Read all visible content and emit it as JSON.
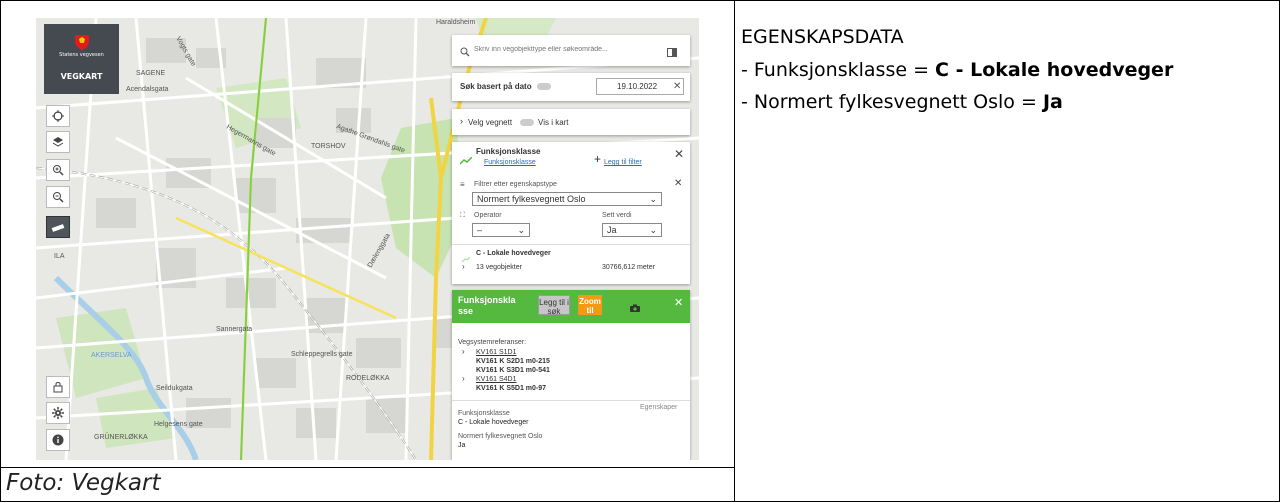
{
  "properties": {
    "title": "EGENSKAPSDATA",
    "items": [
      {
        "prefix": "- ",
        "label": "Funksjonsklasse = ",
        "value": "C - Lokale hovedveger"
      },
      {
        "prefix": "- ",
        "label": "Normert fylkesvegnett Oslo = ",
        "value": "Ja"
      }
    ]
  },
  "caption": "Foto: Vegkart",
  "app": {
    "org": "Statens vegvesen",
    "name": "VEGKART"
  },
  "search": {
    "placeholder": "Skriv inn vegobjekttype eller søkeområde...",
    "date_label": "Søk basert på dato",
    "date_value": "19.10.2022"
  },
  "network": {
    "label": "Velg vegnett",
    "show_label": "Vis i kart"
  },
  "filter_panel": {
    "title": "Funksjonsklasse",
    "sub_link": "Funksjonsklasse",
    "add_filter": "Legg til filter",
    "filter_label": "Filtrer etter egenskapstype",
    "property_select": "Normert fylkesvegnett Oslo",
    "operator_label": "Operator",
    "operator_value": "–",
    "value_label": "Sett verdi",
    "value_value": "Ja",
    "result_class": "C - Lokale hovedveger",
    "result_count": "13 vegobjekter",
    "result_length": "30766,612 meter"
  },
  "detail_panel": {
    "title": "Funksjonskla sse",
    "add_to_search": "Legg til i søk",
    "zoom": "Zoom til",
    "ref_label": "Vegsystemreferanser:",
    "refs": [
      {
        "link": "KV161 S1D1",
        "lines": [
          "KV161 K S2D1 m0-215",
          "KV161 K S3D1 m0-541"
        ]
      },
      {
        "link": "KV161 S4D1",
        "lines": [
          "KV161 K S5D1 m0-97"
        ]
      }
    ],
    "props_tab": "Egenskaper",
    "prop1_name": "Funksjonsklasse",
    "prop1_value": "C - Lokale hovedveger",
    "prop2_name": "Normert fylkesvegnett Oslo",
    "prop2_value": "Ja"
  },
  "map_labels": {
    "l1": "SAGENE",
    "l2": "Acendalsgata",
    "l3": "TORSHOV",
    "l4": "AKERSELVA",
    "l5": "RODELØKKA",
    "l6": "GRÜNERLØKKA",
    "l7": "Haraldsheim",
    "l8": "Agathe Grøndahls gate",
    "l9": "Sannergata",
    "l10": "Helgesens gate",
    "l11": "ILA",
    "l12": "Seildukgata",
    "l13": "Hegermanns gate",
    "l14": "Vogts gate",
    "l15": "Schleppegrells gate",
    "l16": "Dælenggata"
  },
  "colors": {
    "green": "#56b93f",
    "orange": "#f39a12",
    "dark": "#444a4f",
    "road_yellow": "#f6e35a",
    "park": "#c7e3b2"
  }
}
